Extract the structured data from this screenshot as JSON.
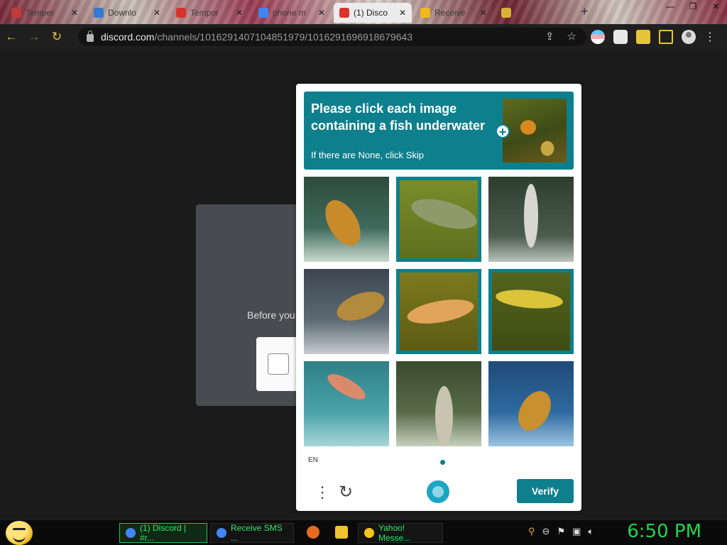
{
  "browser": {
    "tabs": [
      {
        "title": "Temper",
        "favicon": "#c23a3a",
        "active": false
      },
      {
        "title": "Downlo",
        "favicon": "#2f7bd6",
        "active": false
      },
      {
        "title": "Tempor",
        "favicon": "#d9342b",
        "active": false
      },
      {
        "title": "phone m",
        "favicon": "#4285f4",
        "active": false
      },
      {
        "title": "(1) Disco",
        "favicon": "#d9342b",
        "active": true
      },
      {
        "title": "Receive",
        "favicon": "#f0b81a",
        "active": false
      },
      {
        "title": "",
        "favicon": "#d8b23a",
        "active": false
      }
    ],
    "url_host": "discord.com",
    "url_path": "/channels/1016291407104851979/1016291696918679643"
  },
  "page": {
    "before_text": "Before you"
  },
  "captcha": {
    "prompt_title": "Please click each image containing a fish underwater",
    "prompt_subtitle": "If there are None, click Skip",
    "language": "EN",
    "verify_label": "Verify",
    "accent_color": "#0e7f8c",
    "cells": [
      {
        "selected": false,
        "bg": "linear-gradient(180deg,#2e4b3e 0%,#3e6a5b 60%,#c9d9d2 100%)",
        "fish": "#c98a2a",
        "desc": "fish jumping out of water"
      },
      {
        "selected": true,
        "bg": "linear-gradient(180deg,#7a8c2a 0%,#5f6f1e 100%)",
        "fish": "#8f9a6b",
        "desc": "fish underwater"
      },
      {
        "selected": false,
        "bg": "linear-gradient(180deg,#2d3e2e 0%,#4b5c4c 70%,#b9c4bd 100%)",
        "fish": "#d7d7d0",
        "desc": "fish leaping"
      },
      {
        "selected": false,
        "bg": "linear-gradient(180deg,#3c4650 0%,#5c6a73 60%,#c7ccd0 100%)",
        "fish": "#b48a3c",
        "desc": "fish splashing"
      },
      {
        "selected": true,
        "bg": "linear-gradient(180deg,#7b7a1e 0%,#5c5b14 100%)",
        "fish": "#e0a45a",
        "desc": "fish underwater"
      },
      {
        "selected": true,
        "bg": "linear-gradient(180deg,#55631d 0%,#3e4d14 100%)",
        "fish": "#d9c43a",
        "desc": "fish underwater"
      },
      {
        "selected": false,
        "bg": "linear-gradient(180deg,#2f7f86 0%,#4aa3a9 60%,#a9d6d8 100%)",
        "fish": "#d98a6a",
        "desc": "fish jumping"
      },
      {
        "selected": false,
        "bg": "linear-gradient(180deg,#3a4a2e 0%,#596b48 60%,#c6d0be 100%)",
        "fish": "#c9c4b0",
        "desc": "fish leaping"
      },
      {
        "selected": false,
        "bg": "linear-gradient(180deg,#1f4a7a 0%,#2e6aa0 60%,#9cc4e0 100%)",
        "fish": "#c8902e",
        "desc": "fish splashing"
      }
    ]
  },
  "taskbar": {
    "tasks": [
      {
        "label": "(1) Discord | #r...",
        "icon": "#4285f4",
        "active": true
      },
      {
        "label": "Receive SMS ...",
        "icon": "#4285f4",
        "active": false
      },
      {
        "label": "",
        "icon": "#e76b1e",
        "active": false
      },
      {
        "label": "",
        "icon": "#f0c431",
        "active": false
      },
      {
        "label": "Yahoo! Messe...",
        "icon": "#f5c518",
        "active": false
      }
    ],
    "clock": "6:50 PM"
  }
}
